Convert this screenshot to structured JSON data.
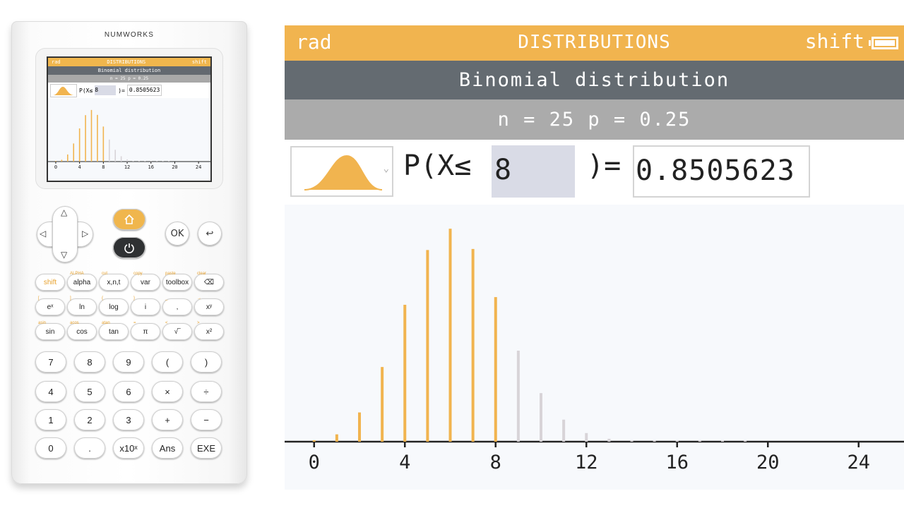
{
  "device": {
    "brand": "NUMWORKS",
    "mini_screen": {
      "top_left": "rad",
      "top_center": "DISTRIBUTIONS",
      "top_right": "shift",
      "title": "Binomial distribution",
      "params": "n = 25 p = 0.25",
      "prob_label": "P(X≤",
      "prob_input": "8",
      "prob_close": ")=",
      "prob_result": "0.8505623",
      "ticks": [
        "0",
        "4",
        "8",
        "12",
        "16",
        "20",
        "24"
      ]
    },
    "buttons": {
      "ok": "OK",
      "keys": [
        {
          "label": "shift",
          "alt": ""
        },
        {
          "label": "alpha",
          "alt": "ALPHA"
        },
        {
          "label": "x,n,t",
          "alt": "cut"
        },
        {
          "label": "var",
          "alt": "copy"
        },
        {
          "label": "toolbox",
          "alt": "paste"
        },
        {
          "label": "⌫",
          "alt": "clear"
        },
        {
          "label": "eˣ",
          "alt": "["
        },
        {
          "label": "ln",
          "alt": "]"
        },
        {
          "label": "log",
          "alt": "{"
        },
        {
          "label": "i",
          "alt": "}"
        },
        {
          "label": ",",
          "alt": "_"
        },
        {
          "label": "xʸ",
          "alt": "→"
        },
        {
          "label": "sin",
          "alt": "asin"
        },
        {
          "label": "cos",
          "alt": "acos"
        },
        {
          "label": "tan",
          "alt": "atan"
        },
        {
          "label": "π",
          "alt": "="
        },
        {
          "label": "√‾",
          "alt": "<"
        },
        {
          "label": "x²",
          "alt": ">"
        },
        {
          "label": "7",
          "alt": ""
        },
        {
          "label": "8",
          "alt": ""
        },
        {
          "label": "9",
          "alt": ""
        },
        {
          "label": "(",
          "alt": ""
        },
        {
          "label": ")",
          "alt": ""
        },
        {
          "label": "4",
          "alt": ""
        },
        {
          "label": "5",
          "alt": ""
        },
        {
          "label": "6",
          "alt": ""
        },
        {
          "label": "×",
          "alt": ""
        },
        {
          "label": "÷",
          "alt": ""
        },
        {
          "label": "1",
          "alt": ""
        },
        {
          "label": "2",
          "alt": ""
        },
        {
          "label": "3",
          "alt": ""
        },
        {
          "label": "+",
          "alt": ""
        },
        {
          "label": "−",
          "alt": ""
        },
        {
          "label": "0",
          "alt": ""
        },
        {
          "label": ".",
          "alt": ""
        },
        {
          "label": "x10ˣ",
          "alt": ""
        },
        {
          "label": "Ans",
          "alt": ""
        },
        {
          "label": "EXE",
          "alt": ""
        }
      ]
    }
  },
  "screen": {
    "top_left": "rad",
    "top_center": "DISTRIBUTIONS",
    "top_right": "shift",
    "title": "Binomial distribution",
    "params": "n = 25 p = 0.25",
    "prob_label": "P(X≤",
    "prob_input": "8",
    "prob_close": ")=",
    "prob_result": "0.8505623"
  },
  "colors": {
    "accent": "#f1b44f",
    "title_bar": "#646b71",
    "sub_bar": "#ababab",
    "input_bg": "#d9dbe6",
    "bar_inactive": "#d8d4d8"
  },
  "chart_data": {
    "type": "bar",
    "title": "",
    "xlabel": "",
    "ylabel": "",
    "x": [
      0,
      1,
      2,
      3,
      4,
      5,
      6,
      7,
      8,
      9,
      10,
      11,
      12,
      13,
      14,
      15,
      16,
      17,
      18,
      19
    ],
    "values": [
      0.0008,
      0.0063,
      0.0251,
      0.0641,
      0.1175,
      0.1645,
      0.1828,
      0.1654,
      0.1241,
      0.0781,
      0.0417,
      0.0189,
      0.0074,
      0.0025,
      0.0007,
      0.0002,
      4e-05,
      1e-05,
      1e-06,
      1e-07
    ],
    "highlight_upto": 8,
    "xticks": [
      0,
      4,
      8,
      12,
      16,
      20,
      24
    ],
    "xlim": [
      -1.3,
      26
    ],
    "ylim": [
      0,
      0.195
    ],
    "grid": false
  }
}
